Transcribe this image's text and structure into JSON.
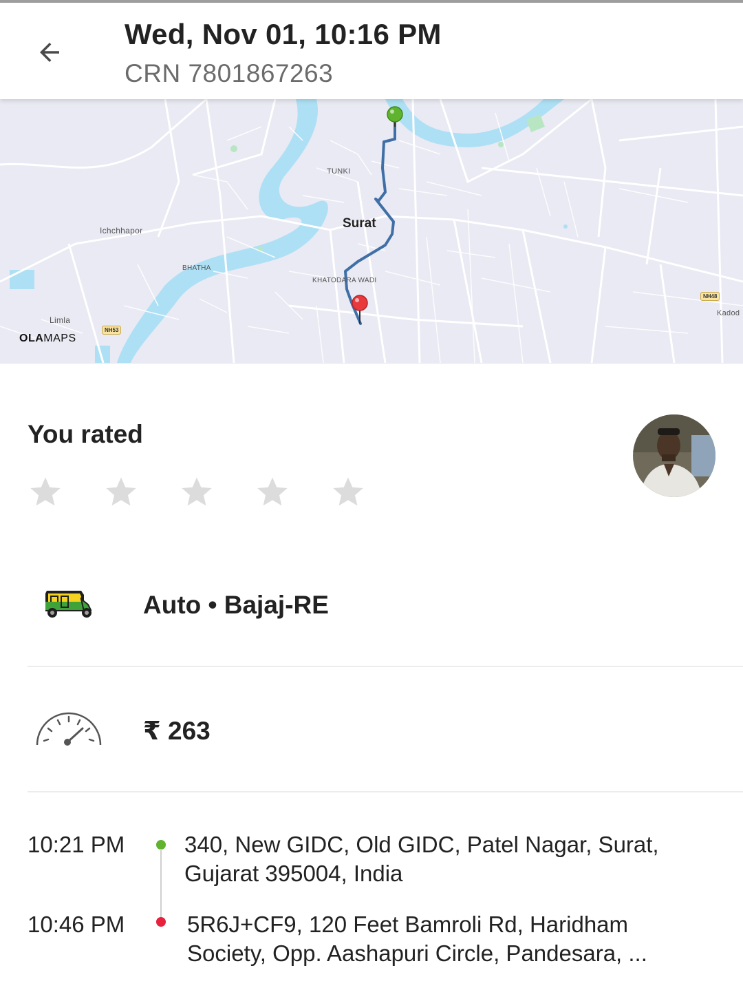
{
  "header": {
    "back_icon": "arrow-left-icon",
    "title": "Wed, Nov 01, 10:16 PM",
    "crn": "CRN 7801867263"
  },
  "map": {
    "city_label": "Surat",
    "place_labels": {
      "tunki": "TUNKI",
      "ichchhapor": "Ichchhapor",
      "bhatha": "BHATHA",
      "khatodara": "KHATODARA WADI",
      "limla": "Limla",
      "kadod": "Kadod"
    },
    "highway_shields": {
      "nh53": "NH53",
      "nh48": "NH48"
    },
    "brand": {
      "bold": "OLA",
      "light": "MAPS"
    },
    "route_color": "#3f6fa6",
    "pickup_pin_color": "#5fb32e",
    "drop_pin_color": "#e8393c",
    "water_color": "#aee0f5",
    "park_color": "#b8e6c2"
  },
  "rating": {
    "title": "You rated",
    "stars": [
      {
        "name": "star-1",
        "filled": false
      },
      {
        "name": "star-2",
        "filled": false
      },
      {
        "name": "star-3",
        "filled": false
      },
      {
        "name": "star-4",
        "filled": false
      },
      {
        "name": "star-5",
        "filled": false
      }
    ],
    "star_color": "#dcdcdc"
  },
  "driver": {
    "avatar_icon": "driver-avatar"
  },
  "vehicle": {
    "icon": "auto-rickshaw-icon",
    "text": "Auto • Bajaj-RE"
  },
  "fare": {
    "icon": "speedometer-icon",
    "amount": "₹ 263"
  },
  "trip": {
    "pickup": {
      "time": "10:21 PM",
      "address_line1": "340, New GIDC, Old GIDC, Patel Nagar, Surat,",
      "address_line2": "Gujarat 395004, India",
      "dot_color": "#5fb32e"
    },
    "drop": {
      "time": "10:46 PM",
      "address_line1": "5R6J+CF9, 120 Feet Bamroli Rd, Haridham",
      "address_line2": "Society, Opp. Aashapuri Circle, Pandesara, ...",
      "dot_color": "#e8213c"
    }
  }
}
